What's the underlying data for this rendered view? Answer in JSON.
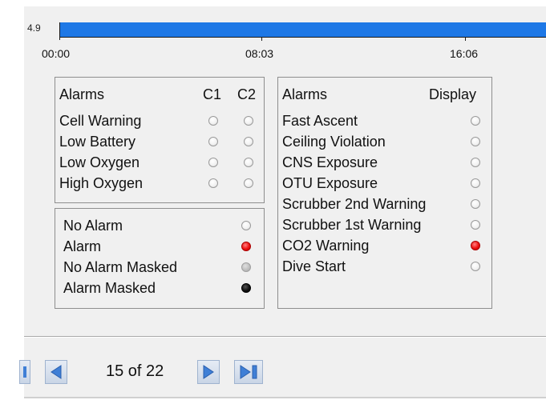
{
  "timeline": {
    "y_label": "4.9",
    "times": [
      "00:00",
      "08:03",
      "16:06"
    ],
    "bar_color": "#1e78e6"
  },
  "alarm_panel": {
    "header": "Alarms",
    "col1": "C1",
    "col2": "C2",
    "rows": [
      {
        "label": "Cell Warning",
        "c1": "off",
        "c2": "off"
      },
      {
        "label": "Low Battery",
        "c1": "off",
        "c2": "off"
      },
      {
        "label": "Low Oxygen",
        "c1": "off",
        "c2": "off"
      },
      {
        "label": "High Oxygen",
        "c1": "off",
        "c2": "off"
      }
    ]
  },
  "legend_panel": {
    "rows": [
      {
        "label": "No Alarm",
        "state": "white"
      },
      {
        "label": "Alarm",
        "state": "red"
      },
      {
        "label": "No Alarm Masked",
        "state": "grey"
      },
      {
        "label": "Alarm Masked",
        "state": "black"
      }
    ]
  },
  "display_panel": {
    "header": "Alarms",
    "col": "Display",
    "rows": [
      {
        "label": "Fast Ascent",
        "state": "white"
      },
      {
        "label": "Ceiling Violation",
        "state": "white"
      },
      {
        "label": "CNS Exposure",
        "state": "white"
      },
      {
        "label": "OTU Exposure",
        "state": "white"
      },
      {
        "label": "Scrubber 2nd Warning",
        "state": "white"
      },
      {
        "label": "Scrubber 1st Warning",
        "state": "white"
      },
      {
        "label": "CO2 Warning",
        "state": "red"
      },
      {
        "label": "Dive Start",
        "state": "white"
      }
    ]
  },
  "navigation": {
    "page_indicator": "15 of 22",
    "icons": [
      "first-page-icon",
      "previous-icon",
      "next-icon",
      "last-page-icon"
    ]
  }
}
